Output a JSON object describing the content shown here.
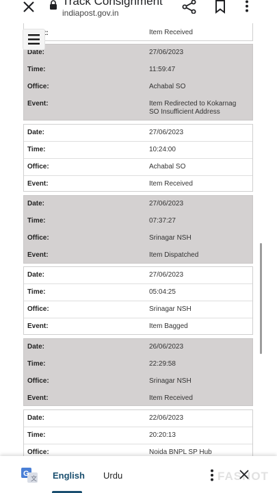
{
  "browser": {
    "page_title": "Track Consignment",
    "url": "indiapost.gov.in"
  },
  "labels": {
    "date": "Date:",
    "time": "Time:",
    "office": "Office:",
    "event": "Event:"
  },
  "partial_card": {
    "label": "Event:",
    "event": "Item Received"
  },
  "records": [
    {
      "date": "27/06/2023",
      "time": "11:59:47",
      "office": "Achabal SO",
      "event_line1": "Item Redirected to Kokarnag",
      "event_line2": "SO Insufficient Address"
    },
    {
      "date": "27/06/2023",
      "time": "10:24:00",
      "office": "Achabal SO",
      "event_line1": "Item Received",
      "event_line2": ""
    },
    {
      "date": "27/06/2023",
      "time": "07:37:27",
      "office": "Srinagar NSH",
      "event_line1": "Item Dispatched",
      "event_line2": ""
    },
    {
      "date": "27/06/2023",
      "time": "05:04:25",
      "office": "Srinagar NSH",
      "event_line1": "Item Bagged",
      "event_line2": ""
    },
    {
      "date": "26/06/2023",
      "time": "22:29:58",
      "office": "Srinagar NSH",
      "event_line1": "Item Received",
      "event_line2": ""
    },
    {
      "date": "22/06/2023",
      "time": "20:20:13",
      "office": "Noida BNPL SP Hub",
      "event_line1": "",
      "event_line2": ""
    }
  ],
  "translate_bar": {
    "lang_selected": "English",
    "lang_other": "Urdu"
  },
  "watermark": "FASHOT",
  "colors": {
    "grey_row": "#d4d1d1",
    "accent": "#1a4f6f"
  }
}
